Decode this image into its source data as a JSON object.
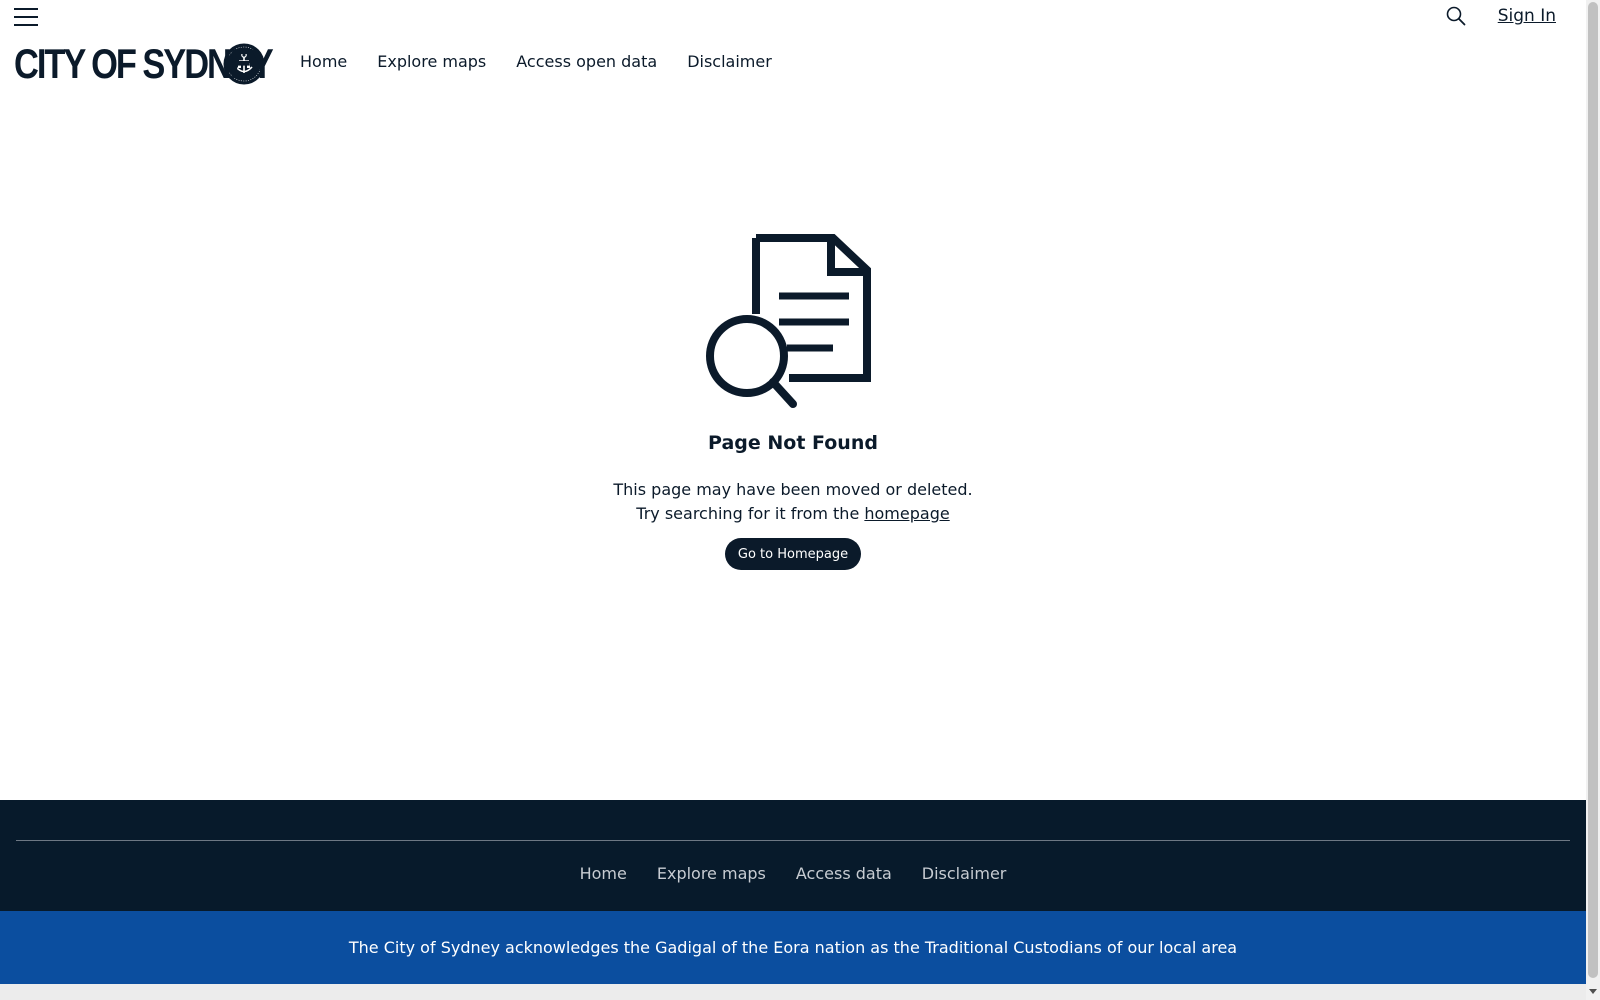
{
  "header": {
    "menu_icon": "hamburger-menu-icon",
    "search_icon": "search-icon",
    "sign_in_label": "Sign In",
    "logo_text": "CITY OF SYDNEY",
    "nav": [
      {
        "label": "Home"
      },
      {
        "label": "Explore maps"
      },
      {
        "label": "Access open data"
      },
      {
        "label": "Disclaimer"
      }
    ]
  },
  "main": {
    "illustration_icon": "document-search-icon",
    "title": "Page Not Found",
    "message_line1": "This page may have been moved or deleted.",
    "message_line2_prefix": "Try searching for it from the ",
    "message_line2_link": "homepage",
    "button_label": "Go to Homepage"
  },
  "footer": {
    "nav": [
      {
        "label": "Home"
      },
      {
        "label": "Explore maps"
      },
      {
        "label": "Access data"
      },
      {
        "label": "Disclaimer"
      }
    ],
    "acknowledgement": "The City of Sydney acknowledges the Gadigal of the Eora nation as the Traditional Custodians of our local area"
  },
  "colors": {
    "navy": "#0b1a2a",
    "footer_bg": "#071a2b",
    "ack_bg": "#0b4e9f",
    "white": "#ffffff"
  }
}
